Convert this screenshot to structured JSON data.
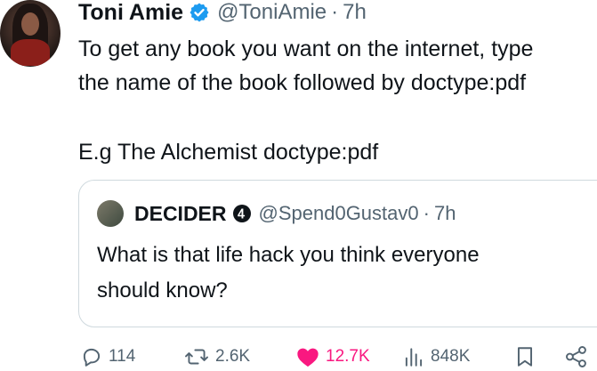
{
  "tweet": {
    "author_name": "Toni Amie",
    "author_handle": "@ToniAmie",
    "separator": "·",
    "time": "7h",
    "text_lines": [
      "To get any book you want on the internet, type",
      "the name of the book followed by doctype:pdf"
    ],
    "example_text": "E.g The Alchemist  doctype:pdf"
  },
  "quote": {
    "author_name": "DECIDER",
    "author_handle": "@Spend0Gustav0",
    "separator": "·",
    "time": "7h",
    "text_lines": [
      "What is that life hack you think everyone",
      "should know?"
    ]
  },
  "actions": {
    "replies": "114",
    "reposts": "2.6K",
    "likes": "12.7K",
    "views": "848K"
  },
  "colors": {
    "verified_blue": "#1d9bf0",
    "like_pink": "#f91880",
    "muted": "#536471",
    "border": "#cfd9de"
  },
  "icons": [
    "verified-badge-icon",
    "reply-icon",
    "repost-icon",
    "like-icon",
    "views-icon",
    "bookmark-icon",
    "share-icon"
  ]
}
